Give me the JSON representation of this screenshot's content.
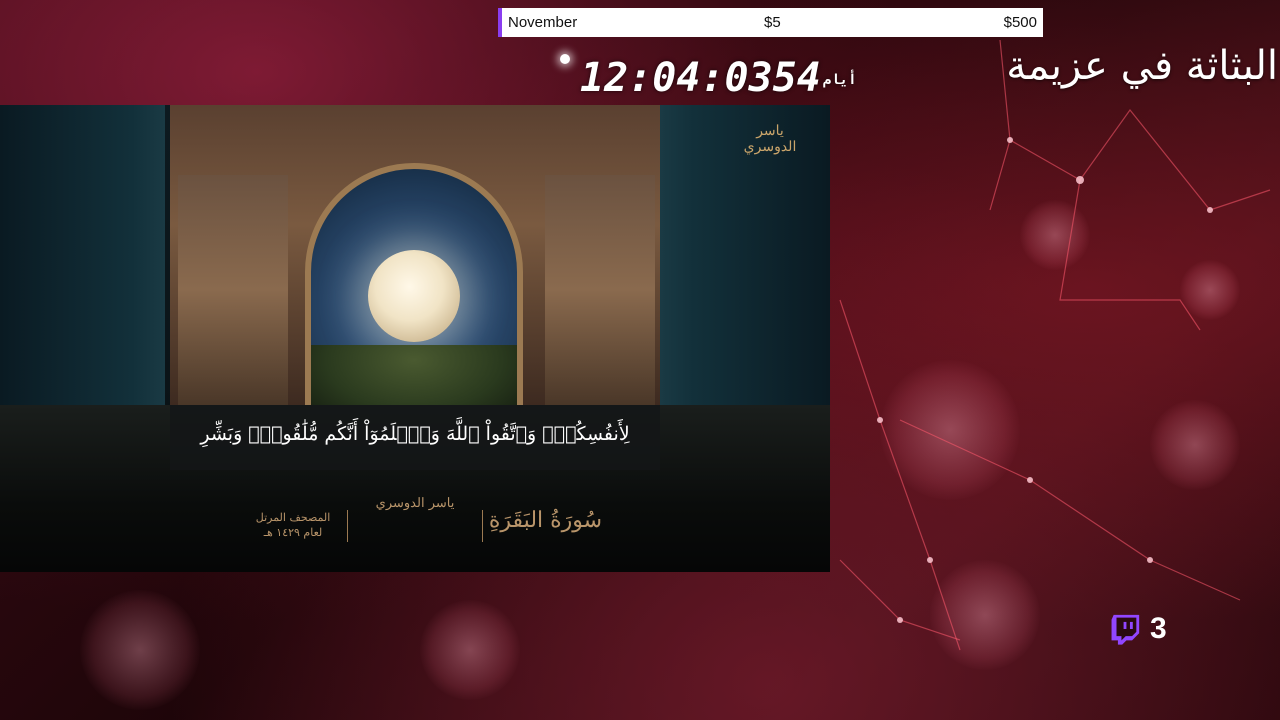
{
  "goal_bar": {
    "month": "November",
    "current": "$5",
    "target": "$500",
    "accent_color": "#8a3df0"
  },
  "countdown": {
    "time": "12:04:03",
    "days_word": "أيام",
    "days": "54"
  },
  "headline": "البثاثة في عزيمة",
  "video": {
    "calligraphy_top": "ياسر الدوسري",
    "verse": "لِأَنفُسِكُمْۚ وَٱتَّقُواْ ٱللَّهَ وَٱعۡلَمُوٓاْ أَنَّكُم مُّلَٰقُوهُۗ وَبَشِّرِ",
    "surah": "سُورَةُ البَقَرَةِ",
    "reciter": "ياسر الدوسري",
    "mushaf_line1": "المصحف المرتل",
    "mushaf_line2": "لعام ١٤٢٩ هـ"
  },
  "viewers": {
    "icon": "twitch-icon",
    "count": "3",
    "icon_color": "#9146ff"
  }
}
